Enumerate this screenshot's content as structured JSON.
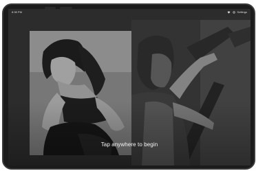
{
  "status_bar": {
    "time": "8:38 PM",
    "settings_label": "Settings"
  },
  "main": {
    "call_to_action": "Tap anywhere to begin"
  },
  "icons": {
    "wifi": "wifi-icon",
    "settings": "gear-icon"
  },
  "colors": {
    "bezel": "#1b1b1b",
    "text": "#f5f5f5"
  }
}
